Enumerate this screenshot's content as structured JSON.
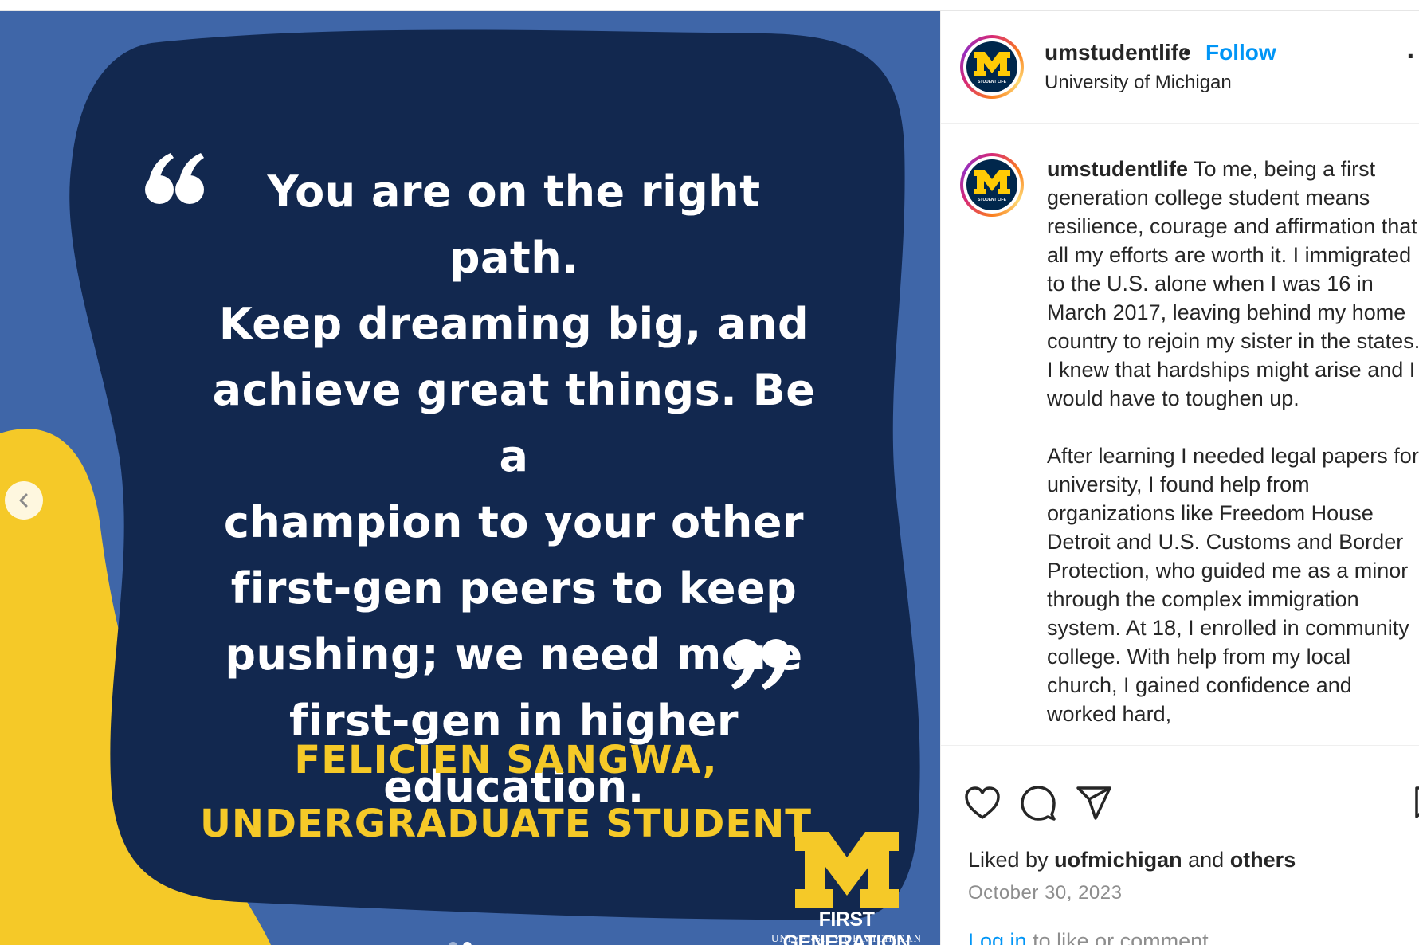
{
  "post": {
    "quote": "You are on the right path. Keep dreaming big, and achieve great things. Be a champion to your other first-gen peers to keep pushing; we need more first-gen in higher education.",
    "quote_lines": [
      "You are on the right path.",
      "Keep dreaming big, and",
      "achieve great things. Be a",
      "champion to your other",
      "first-gen peers to keep",
      "pushing; we need more",
      "first-gen in higher",
      "education."
    ],
    "attribution_line1": "FELICIEN SANGWA,",
    "attribution_line2": "UNDERGRADUATE STUDENT",
    "brand_letter": "M",
    "brand_title": "FIRST GENERATION",
    "brand_subtitle": "UNIVERSITY OF MICHIGAN",
    "carousel": {
      "total": 2,
      "active": 2
    },
    "colors": {
      "background": "#3f66a8",
      "blob": "#12284f",
      "accent": "#f5c928"
    }
  },
  "header": {
    "username": "umstudentlife",
    "separator": "•",
    "follow_label": "Follow",
    "location": "University of Michigan",
    "avatar_letter": "M",
    "avatar_sub": "STUDENT LIFE",
    "more_icon": "more-options-icon"
  },
  "caption": {
    "username": "umstudentlife",
    "paragraph1": "To me, being a first generation college student means resilience, courage and affirmation that all my efforts are worth it. I immigrated to the U.S. alone when I was 16 in March 2017, leaving behind my home country to rejoin my sister in the states. I knew that hardships might arise and I would have to toughen up.",
    "paragraph2": "After learning I needed legal papers for university, I found help from organizations like Freedom House Detroit and U.S. Customs and Border Protection, who guided me as a minor through the complex immigration system. At 18, I enrolled in community college. With help from my local church, I gained confidence and worked hard,"
  },
  "actions": {
    "icons": [
      "heart-icon",
      "comment-icon",
      "share-icon",
      "bookmark-icon"
    ]
  },
  "likes": {
    "prefix": "Liked by",
    "user": "uofmichigan",
    "joiner": "and",
    "others": "others"
  },
  "date": "October 30, 2023",
  "login": {
    "link": "Log in",
    "rest": "to like or comment."
  },
  "colors": {
    "link": "#0095f6",
    "text": "#262626",
    "muted": "#8e8e8e"
  }
}
